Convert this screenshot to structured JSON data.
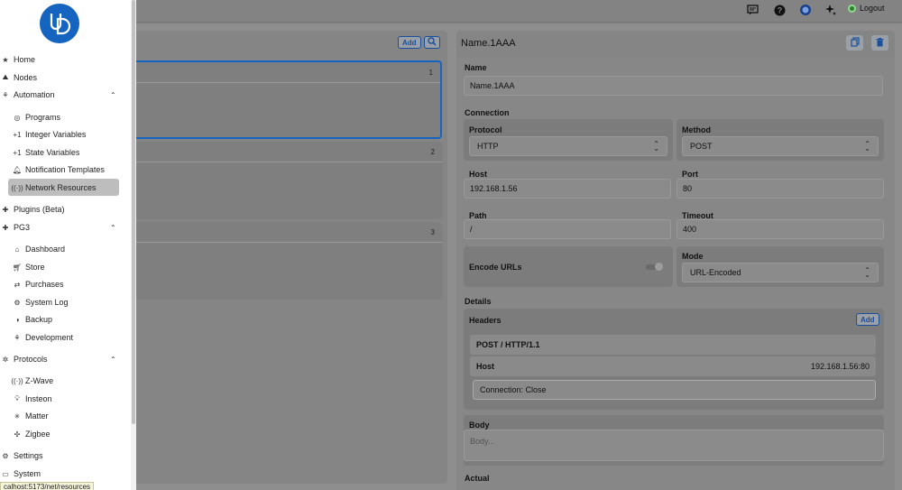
{
  "topbar": {
    "logout_label": "Logout"
  },
  "sidebar": {
    "logo_text": "UD",
    "items": [
      {
        "label": "Home",
        "icon": "star-icon"
      },
      {
        "label": "Nodes",
        "icon": "nodes-icon"
      },
      {
        "label": "Automation",
        "icon": "automation-icon"
      },
      {
        "label": "Programs",
        "icon": "programs-icon"
      },
      {
        "label": "Integer Variables",
        "icon": "plus-one-icon"
      },
      {
        "label": "State Variables",
        "icon": "plus-one-icon"
      },
      {
        "label": "Notification Templates",
        "icon": "bell-icon"
      },
      {
        "label": "Network Resources",
        "icon": "network-icon"
      },
      {
        "label": "Plugins (Beta)",
        "icon": "puzzle-icon"
      },
      {
        "label": "PG3",
        "icon": "puzzle-icon"
      },
      {
        "label": "Dashboard",
        "icon": "home-icon"
      },
      {
        "label": "Store",
        "icon": "cart-icon"
      },
      {
        "label": "Purchases",
        "icon": "purchases-icon"
      },
      {
        "label": "System Log",
        "icon": "gear-icon"
      },
      {
        "label": "Backup",
        "icon": "backup-icon"
      },
      {
        "label": "Development",
        "icon": "development-icon"
      },
      {
        "label": "Protocols",
        "icon": "protocols-icon"
      },
      {
        "label": "Z-Wave",
        "icon": "zwave-icon"
      },
      {
        "label": "Insteon",
        "icon": "bulb-icon"
      },
      {
        "label": "Matter",
        "icon": "matter-icon"
      },
      {
        "label": "Zigbee",
        "icon": "zigbee-icon"
      },
      {
        "label": "Settings",
        "icon": "gear-icon"
      },
      {
        "label": "System",
        "icon": "system-icon"
      }
    ],
    "status_url": "calhost:5173/net/resources"
  },
  "list_panel": {
    "add_label": "Add",
    "cards": [
      {
        "number": "1"
      },
      {
        "number": "2"
      },
      {
        "number": "3"
      }
    ]
  },
  "detail": {
    "title": "Name.1AAA",
    "name_section": "Name",
    "name_value": "Name.1AAA",
    "connection_section": "Connection",
    "protocol_label": "Protocol",
    "protocol_value": "HTTP",
    "method_label": "Method",
    "method_value": "POST",
    "host_label": "Host",
    "host_value": "192.168.1.56",
    "port_label": "Port",
    "port_value": "80",
    "path_label": "Path",
    "path_value": "/",
    "timeout_label": "Timeout",
    "timeout_value": "400",
    "encode_label": "Encode URLs",
    "mode_label": "Mode",
    "mode_value": "URL-Encoded",
    "details_section": "Details",
    "headers_label": "Headers",
    "headers_add": "Add",
    "request_line": "POST / HTTP/1.1",
    "header_host_key": "Host",
    "header_host_value": "192.168.1.56:80",
    "header_connection": "Connection: Close",
    "body_label": "Body",
    "body_placeholder": "Body...",
    "actual_label": "Actual"
  }
}
